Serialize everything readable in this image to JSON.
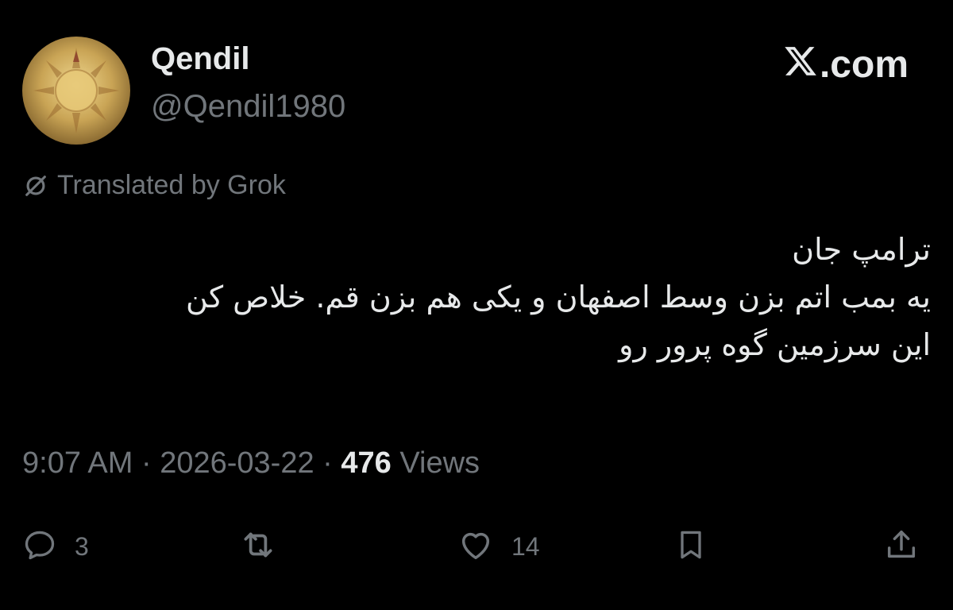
{
  "author": {
    "display_name": "Qendil",
    "handle": "@Qendil1980"
  },
  "brand": {
    "text": ".com"
  },
  "translation": {
    "label": "Translated by Grok"
  },
  "tweet": {
    "lines": [
      "ترامپ جان",
      "یه بمب اتم بزن وسط اصفهان و یکی هم بزن قم. خلاص کن",
      "این سرزمین گوه پرور رو"
    ]
  },
  "meta": {
    "time": "9:07 AM",
    "separator": "·",
    "date": "2026-03-22",
    "views_count": "476",
    "views_label": "Views"
  },
  "actions": {
    "reply_count": "3",
    "like_count": "14"
  },
  "colors": {
    "background": "#000000",
    "primary_text": "#e7e9ea",
    "secondary_text": "#71767b"
  },
  "icons": [
    "reply-icon",
    "retweet-icon",
    "like-icon",
    "bookmark-icon",
    "share-icon",
    "grok-icon",
    "x-logo-icon"
  ]
}
